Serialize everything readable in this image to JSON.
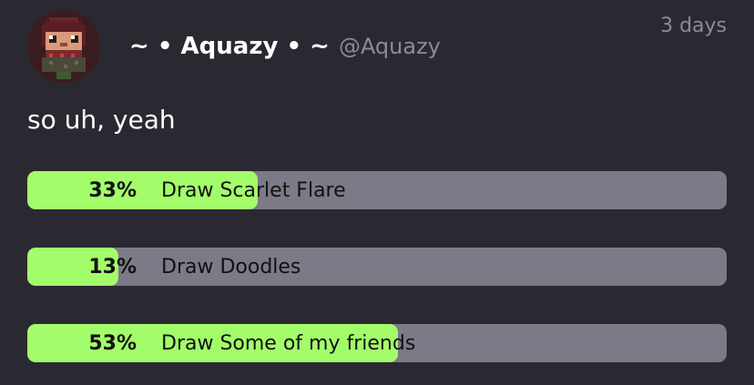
{
  "post": {
    "display_name": "Aquazy",
    "name_prefix": "~ •",
    "name_suffix": "• ~",
    "handle": "@Aquazy",
    "timestamp": "3 days",
    "text": "so uh, yeah"
  },
  "poll": {
    "options": [
      {
        "percent_label": "33%",
        "label": "Draw Scarlet Flare",
        "fraction": 0.33
      },
      {
        "percent_label": "13%",
        "label": "Draw Doodles",
        "fraction": 0.13
      },
      {
        "percent_label": "53%",
        "label": "Draw Some of my friends",
        "fraction": 0.53
      }
    ]
  },
  "colors": {
    "background": "#2a2932",
    "poll_track": "#7c7a86",
    "poll_fill": "#a3fc6a",
    "secondary_text": "#8c8a96"
  },
  "icons": {
    "avatar": "pixel-art-avatar-icon"
  }
}
